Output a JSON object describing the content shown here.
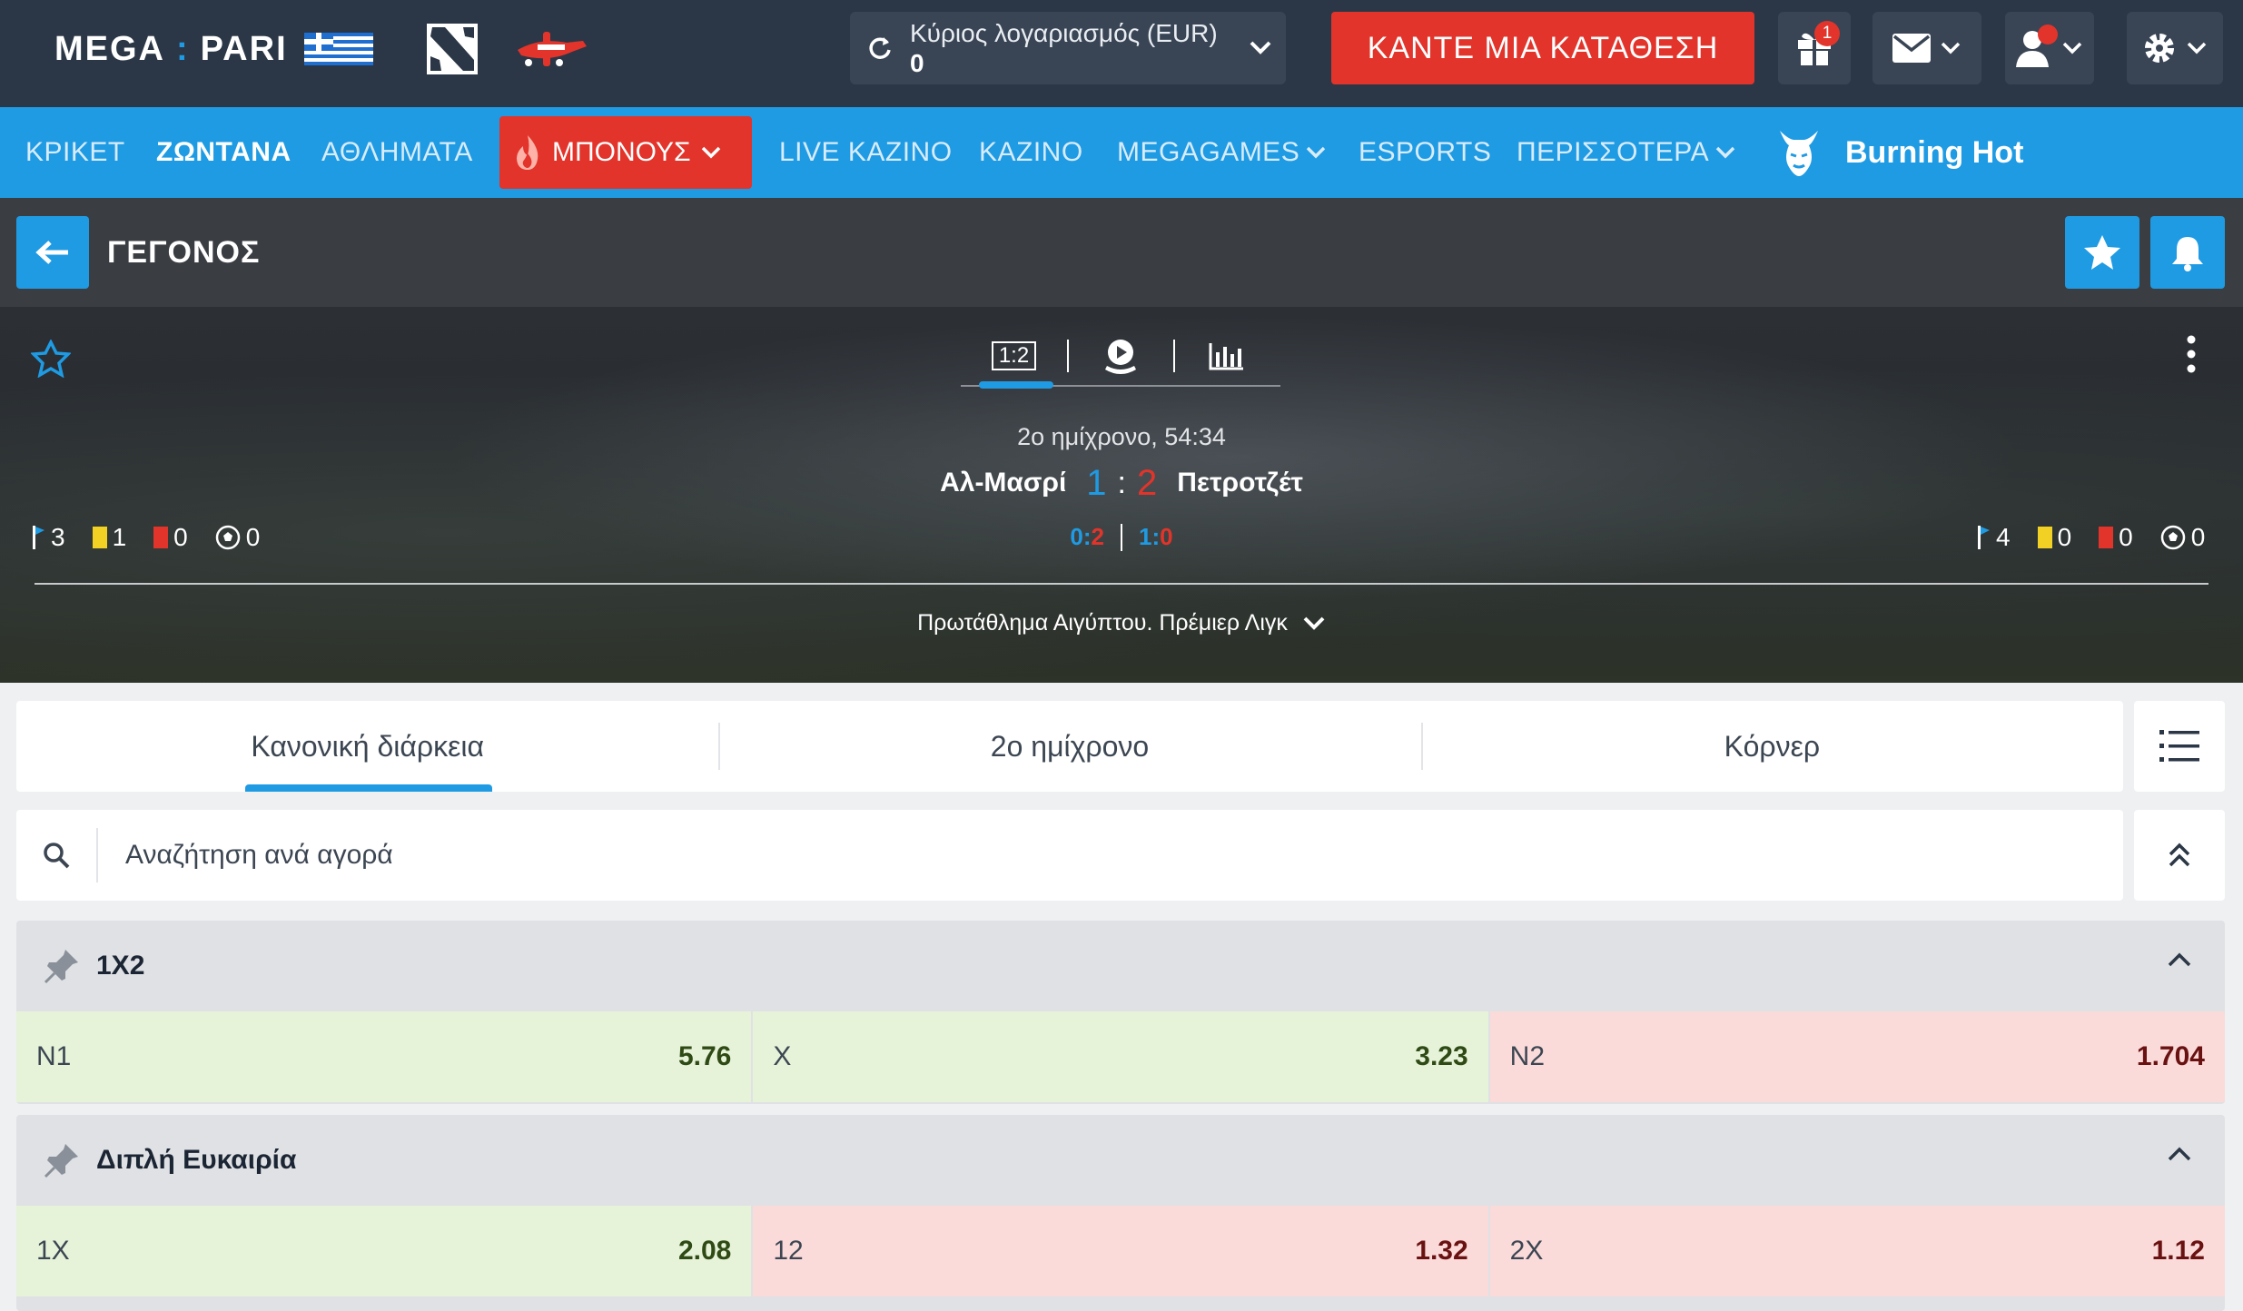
{
  "header": {
    "logo_left": "MEGA",
    "logo_colon": ":",
    "logo_right": "PARI",
    "account_label": "Κύριος λογαριασμός (EUR)",
    "account_amount": "0",
    "deposit_label": "ΚΑΝΤΕ ΜΙΑ ΚΑΤΑΘΕΣΗ",
    "gift_badge": "1"
  },
  "nav": {
    "items": [
      "ΚΡΙΚΕΤ",
      "ΖΩΝΤΑΝΑ",
      "ΑΘΛΗΜΑΤΑ",
      "ΜΠΟΝΟΥΣ",
      "LIVE ΚΑΖΙΝΟ",
      "ΚΑΖΙΝΟ",
      "MEGAGAMES",
      "ESPORTS",
      "ΠΕΡΙΣΣΟΤΕΡΑ"
    ],
    "promo": "Burning Hot"
  },
  "event": {
    "title": "ΓΕΓΟΝΟΣ"
  },
  "scoreboard": {
    "tab_score": "1:2",
    "period_status": "2ο ημίχρονο, 54:34",
    "home_team": "Αλ-Μασρί",
    "away_team": "Πετροτζέτ",
    "home_score": "1",
    "score_separator": ":",
    "away_score": "2",
    "period1": {
      "home": "0",
      "away": "2"
    },
    "period2": {
      "home": "1",
      "away": "0"
    },
    "period_separator": ":",
    "home_stats": {
      "corners": "3",
      "yellow": "1",
      "red": "0",
      "balls": "0"
    },
    "away_stats": {
      "corners": "4",
      "yellow": "0",
      "red": "0",
      "balls": "0"
    },
    "league": "Πρωτάθλημα Αιγύπτου. Πρέμιερ Λιγκ"
  },
  "period_tabs": [
    "Κανονική διάρκεια",
    "2ο ημίχρονο",
    "Κόρνερ"
  ],
  "search": {
    "placeholder": "Αναζήτηση ανά αγορά"
  },
  "markets": [
    {
      "title": "1X2",
      "odds": [
        {
          "label": "Ν1",
          "value": "5.76",
          "trend": "up"
        },
        {
          "label": "Χ",
          "value": "3.23",
          "trend": "up"
        },
        {
          "label": "Ν2",
          "value": "1.704",
          "trend": "down"
        }
      ]
    },
    {
      "title": "Διπλή Ευκαιρία",
      "odds": [
        {
          "label": "1Χ",
          "value": "2.08",
          "trend": "up"
        },
        {
          "label": "12",
          "value": "1.32",
          "trend": "down"
        },
        {
          "label": "2Χ",
          "value": "1.12",
          "trend": "down"
        }
      ]
    }
  ],
  "colors": {
    "header_bg": "#2b3746",
    "nav_bg": "#1f9be3",
    "accent_red": "#e2342b",
    "odd_up_bg": "#e6f3d9",
    "odd_down_bg": "#fbdada"
  }
}
